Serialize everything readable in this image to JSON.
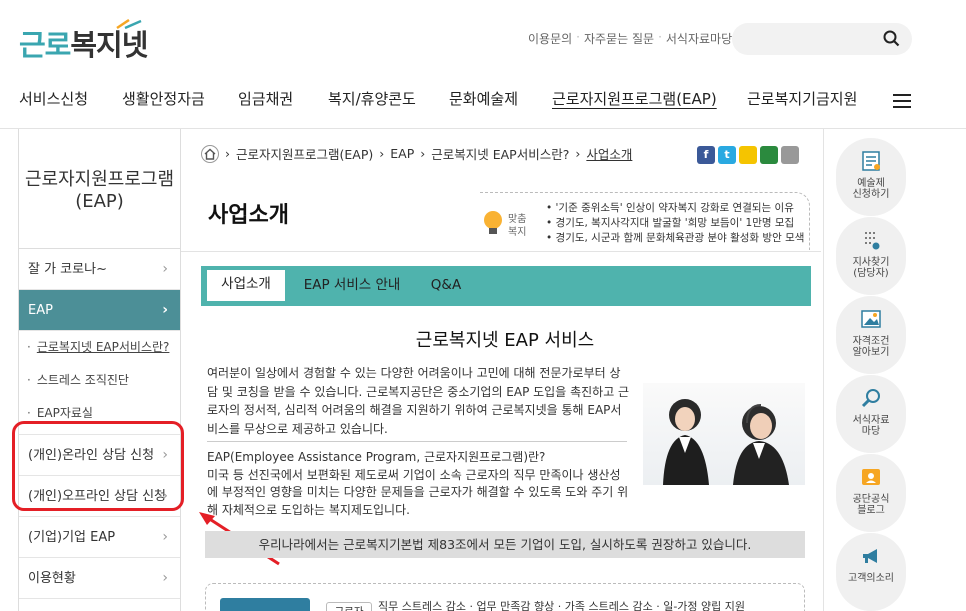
{
  "header": {
    "logo_a": "근로",
    "logo_b": "복지넷",
    "top_links": [
      "이용문의",
      "자주묻는 질문",
      "서식자료마당"
    ],
    "search_placeholder": ""
  },
  "gnb": [
    "서비스신청",
    "생활안정자금",
    "임금채권",
    "복지/휴양콘도",
    "문화예술제",
    "근로자지원프로그램(EAP)",
    "근로복지기금지원"
  ],
  "gnb_active": "근로자지원프로그램(EAP)",
  "left_nav": {
    "title_line1": "근로자지원프로그램",
    "title_line2": "(EAP)",
    "items": [
      {
        "label": "잘 가 코로나~"
      },
      {
        "label": "EAP"
      }
    ],
    "subs": [
      "근로복지넷 EAP서비스란?",
      "스트레스 조직진단",
      "EAP자료실"
    ],
    "items2": [
      {
        "label": "(개인)온라인 상담 신청"
      },
      {
        "label": "(개인)오프라인 상담 신청"
      },
      {
        "label": "(기업)기업 EAP"
      },
      {
        "label": "이용현황"
      }
    ]
  },
  "breadcrumb": [
    "근로자지원프로그램(EAP)",
    "EAP",
    "근로복지넷 EAP서비스란?",
    "사업소개"
  ],
  "page_title": "사업소개",
  "tip": {
    "label_1": "맞춤",
    "label_2": "복지",
    "items": [
      "'기준 중위소득' 인상이 약자복지 강화로 연결되는 이유",
      "경기도, 복지사각지대 발굴할 '희망 보듬이' 1만명 모집",
      "경기도, 시군과 함께 문화체육관광 분야 활성화 방안 모색"
    ]
  },
  "tabs": [
    "사업소개",
    "EAP 서비스 안내",
    "Q&A"
  ],
  "content": {
    "title": "근로복지넷 EAP 서비스",
    "para1": "여러분이 일상에서 경험할 수 있는 다양한 어려움이나 고민에 대해 전문가로부터 상담 및 코칭을 받을 수 있습니다. 근로복지공단은 중소기업의 EAP 도입을 촉진하고 근로자의 정서적, 심리적 어려움의 해결을 지원하기 위하여 근로복지넷을 통해 EAP서비스를 무상으로 제공하고 있습니다.",
    "para2_q": "EAP(Employee Assistance Program, 근로자지원프로그램)란?",
    "para2": "미국 등 선진국에서 보편화된 제도로써 기업이 소속 근로자의 직무 만족이나 생산성에 부정적인 영향을 미치는 다양한 문제들을 근로자가 해결할 수 있도록 도와 주기 위해 자체적으로 도입하는 복지제도입니다.",
    "gray_bar": "우리나라에서는 근로복지기본법 제83조에서 모든 기업이 도입, 실시하도록 권장하고 있습니다.",
    "bottom_tag": "근로자",
    "bottom_text": "직무 스트레스 감소 · 업무 만족감 향상 · 가족 스트레스 감소 · 일-가정 양립 지원"
  },
  "quick_menu": [
    {
      "l1": "예술제",
      "l2": "신청하기",
      "icon": "document-list-icon"
    },
    {
      "l1": "지사찾기",
      "l2": "(담당자)",
      "icon": "location-list-icon"
    },
    {
      "l1": "자격조건",
      "l2": "알아보기",
      "icon": "picture-icon"
    },
    {
      "l1": "서식자료",
      "l2": "마당",
      "icon": "search-magnifier-icon"
    },
    {
      "l1": "공단공식",
      "l2": "블로그",
      "icon": "blog-icon"
    },
    {
      "l1": "고객의소리",
      "l2": "",
      "icon": "megaphone-icon"
    }
  ],
  "colors": {
    "teal": "#4fb3ad",
    "nav_active": "#4c8f97",
    "highlight": "#e41f26"
  }
}
